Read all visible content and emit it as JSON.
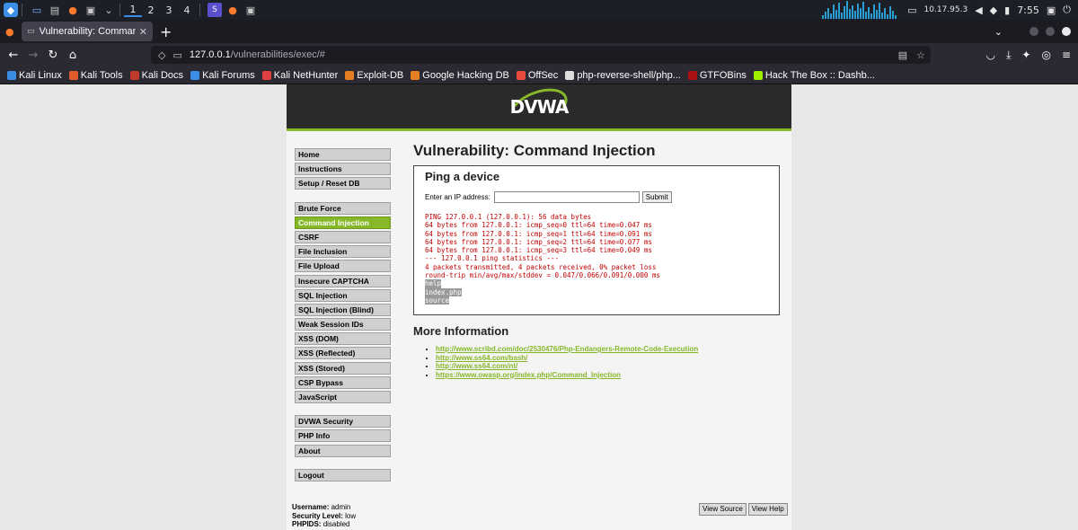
{
  "panel": {
    "workspaces": [
      "1",
      "2",
      "3",
      "4"
    ],
    "ip": "10.17.95.3",
    "time": "7:55"
  },
  "browser": {
    "tab_title": "Vulnerability: Command I",
    "url_host": "127.0.0.1",
    "url_path": "/vulnerabilities/exec/#"
  },
  "bookmarks": [
    {
      "label": "Kali Linux",
      "color": "#3a8ee6"
    },
    {
      "label": "Kali Tools",
      "color": "#e05a2b"
    },
    {
      "label": "Kali Docs",
      "color": "#c0392b"
    },
    {
      "label": "Kali Forums",
      "color": "#3a8ee6"
    },
    {
      "label": "Kali NetHunter",
      "color": "#e04040"
    },
    {
      "label": "Exploit-DB",
      "color": "#e67e22"
    },
    {
      "label": "Google Hacking DB",
      "color": "#e67e22"
    },
    {
      "label": "OffSec",
      "color": "#e74c3c"
    },
    {
      "label": "php-reverse-shell/php...",
      "color": "#dddddd"
    },
    {
      "label": "GTFOBins",
      "color": "#aa1111"
    },
    {
      "label": "Hack The Box :: Dashb...",
      "color": "#9fef00"
    }
  ],
  "dvwa": {
    "logo": "DVWA",
    "menu_groups": [
      [
        "Home",
        "Instructions",
        "Setup / Reset DB"
      ],
      [
        "Brute Force",
        "Command Injection",
        "CSRF",
        "File Inclusion",
        "File Upload",
        "Insecure CAPTCHA",
        "SQL Injection",
        "SQL Injection (Blind)",
        "Weak Session IDs",
        "XSS (DOM)",
        "XSS (Reflected)",
        "XSS (Stored)",
        "CSP Bypass",
        "JavaScript"
      ],
      [
        "DVWA Security",
        "PHP Info",
        "About"
      ],
      [
        "Logout"
      ]
    ],
    "active_menu": "Command Injection",
    "page_title": "Vulnerability: Command Injection",
    "box_title": "Ping a device",
    "ip_label": "Enter an IP address:",
    "ip_value": "",
    "submit_label": "Submit",
    "output_lines": [
      "PING 127.0.0.1 (127.0.0.1): 56 data bytes",
      "64 bytes from 127.0.0.1: icmp_seq=0 ttl=64 time=0.047 ms",
      "64 bytes from 127.0.0.1: icmp_seq=1 ttl=64 time=0.091 ms",
      "64 bytes from 127.0.0.1: icmp_seq=2 ttl=64 time=0.077 ms",
      "64 bytes from 127.0.0.1: icmp_seq=3 ttl=64 time=0.049 ms",
      "--- 127.0.0.1 ping statistics ---",
      "4 packets transmitted, 4 packets received, 0% packet loss",
      "round-trip min/avg/max/stddev = 0.047/0.066/0.091/0.000 ms"
    ],
    "selected_lines": [
      "help",
      "index.php",
      "source"
    ],
    "more_info_title": "More Information",
    "links": [
      "http://www.scribd.com/doc/2530476/Php-Endangers-Remote-Code-Execution",
      "http://www.ss64.com/bash/",
      "http://www.ss64.com/nt/",
      "https://www.owasp.org/index.php/Command_Injection"
    ],
    "user": {
      "username_label": "Username:",
      "username": "admin",
      "security_label": "Security Level:",
      "security": "low",
      "phpids_label": "PHPIDS:",
      "phpids": "disabled"
    },
    "view_source_label": "View Source",
    "view_help_label": "View Help",
    "accent_color": "#86b82a"
  }
}
